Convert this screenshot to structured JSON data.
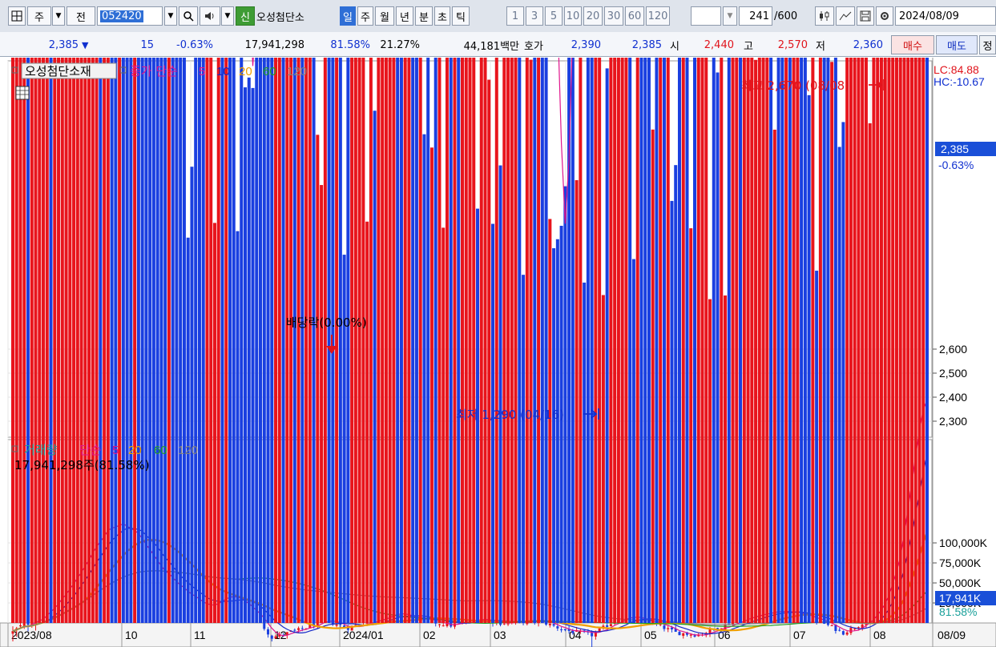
{
  "toolbar": {
    "market_label": "주",
    "prev_label": "전",
    "code_value": "052420",
    "sin_badge": "신",
    "stock_name": "오성첨단소",
    "periods": [
      "일",
      "주",
      "월",
      "년",
      "분",
      "초",
      "틱"
    ],
    "period_selected": "일",
    "intervals": [
      "1",
      "3",
      "5",
      "10",
      "20",
      "30",
      "60",
      "120"
    ],
    "count_value": "241",
    "count_total": "/600",
    "date_value": "2024/08/09",
    "icons": [
      "grid-menu-icon",
      "dropdown-arrow-icon",
      "search-icon",
      "speaker-icon",
      "candle-chart-icon",
      "line-tool-icon",
      "save-icon",
      "settings-icon"
    ]
  },
  "quote": {
    "price": "2,385",
    "change_arrow": "▼",
    "change": "15",
    "change_pct": "-0.63%",
    "volume": "17,941,298",
    "vol_ratio": "81.58%",
    "turnover_pct": "21.27%",
    "trade_value": "44,181백만",
    "hoga_label": "호가",
    "ask": "2,390",
    "bid": "2,385",
    "open_label": "시",
    "open": "2,440",
    "high_label": "고",
    "high": "2,570",
    "low_label": "저",
    "low": "2,360",
    "buy_label": "매수",
    "sell_label": "매도",
    "extra_label": "정"
  },
  "price_panel": {
    "legend_name": "오성첨단소재",
    "legend_ma_title": "종가 단순",
    "ma_periods": [
      "5",
      "10",
      "20",
      "60",
      "120"
    ],
    "lc_text": "LC:84.88",
    "hc_text": "HC:-10.67",
    "current_price_tag": "2,385",
    "current_change_tag": "-0.63%",
    "max_annotation": "최고 2,670 (08/08)",
    "min_annotation": "최저 1,290 (04/16)",
    "dividend_annotation": "배당락(0.00%)"
  },
  "volume_panel": {
    "legend_title": "거래량",
    "legend_ma_title": "단순",
    "ma_periods": [
      "5",
      "20",
      "60",
      "120"
    ],
    "volume_text": "17,941,298주(81.58%)",
    "current_volume_tag": "17,941K",
    "current_ratio_tag": "81.58%"
  },
  "colors": {
    "up": "#e8141c",
    "down": "#1a3fe0",
    "ma5": "#e0148c",
    "ma10": "#1428c8",
    "ma20": "#f0a000",
    "ma60": "#20a020",
    "ma120": "#808080"
  },
  "chart_data": [
    {
      "type": "candlestick",
      "title": "오성첨단소재",
      "ylim": [
        1220,
        2700
      ],
      "y_ticks": [
        1300,
        1400,
        1500,
        1600,
        1700,
        1800,
        1900,
        2000,
        2100,
        2200,
        2300,
        2400,
        2500,
        2600
      ],
      "x_axis_labels": [
        "2023/08",
        "10",
        "11",
        "12",
        "2024/01",
        "02",
        "03",
        "04",
        "05",
        "06",
        "07",
        "08"
      ],
      "x_axis_end_label": "08/09",
      "num_bars": 241,
      "close_path_keypoints": [
        [
          0,
          1420
        ],
        [
          10,
          1530
        ],
        [
          18,
          1720
        ],
        [
          25,
          1900
        ],
        [
          30,
          1850
        ],
        [
          38,
          1680
        ],
        [
          44,
          1600
        ],
        [
          50,
          1520
        ],
        [
          56,
          1580
        ],
        [
          62,
          1520
        ],
        [
          68,
          1400
        ],
        [
          75,
          1430
        ],
        [
          82,
          1470
        ],
        [
          88,
          1440
        ],
        [
          94,
          1470
        ],
        [
          100,
          1500
        ],
        [
          108,
          1470
        ],
        [
          115,
          1450
        ],
        [
          122,
          1480
        ],
        [
          128,
          1460
        ],
        [
          138,
          1470
        ],
        [
          145,
          1430
        ],
        [
          152,
          1410
        ],
        [
          160,
          1490
        ],
        [
          168,
          1460
        ],
        [
          174,
          1420
        ],
        [
          180,
          1410
        ],
        [
          185,
          1440
        ],
        [
          190,
          1470
        ],
        [
          196,
          1500
        ],
        [
          200,
          1510
        ],
        [
          206,
          1500
        ],
        [
          210,
          1480
        ],
        [
          214,
          1450
        ],
        [
          218,
          1420
        ],
        [
          222,
          1450
        ],
        [
          226,
          1500
        ],
        [
          229,
          1600
        ],
        [
          232,
          1800
        ],
        [
          235,
          2150
        ],
        [
          237,
          2400
        ],
        [
          239,
          2460
        ],
        [
          240,
          2385
        ]
      ],
      "max_point": {
        "value": 2670,
        "date": "08/08"
      },
      "min_point": {
        "value": 1290,
        "date": "04/16"
      },
      "last_close": 2385,
      "ma_periods": [
        5,
        10,
        20,
        60,
        120
      ]
    },
    {
      "type": "bar",
      "title": "거래량",
      "ylim": [
        0,
        125000
      ],
      "y_ticks": [
        25000,
        50000,
        75000,
        100000
      ],
      "y_tick_labels": [
        "25,000K",
        "50,000K",
        "75,000K",
        "100,000K"
      ],
      "units": "K",
      "spikes": [
        [
          11,
          47000
        ],
        [
          16,
          14000
        ],
        [
          39,
          17000
        ],
        [
          193,
          8000
        ],
        [
          205,
          12000
        ],
        [
          233,
          118000
        ],
        [
          235,
          105000
        ],
        [
          237,
          58000
        ],
        [
          239,
          44000
        ],
        [
          240,
          17941
        ]
      ],
      "last_volume": 17941298,
      "last_ratio_pct": 81.58
    }
  ]
}
